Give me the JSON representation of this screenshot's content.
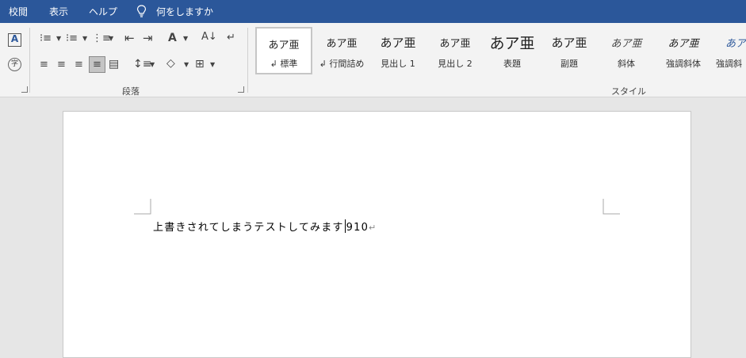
{
  "menu": {
    "items": [
      "校閲",
      "表示",
      "ヘルプ"
    ],
    "tell_me": "何をしますか"
  },
  "ribbon": {
    "paragraph_group_label": "段落",
    "styles_group_label": "スタイル",
    "styles": [
      {
        "preview": "あア亜",
        "name": "標準",
        "selected": true
      },
      {
        "preview": "あア亜",
        "name": "行間詰め"
      },
      {
        "preview": "あア亜",
        "name": "見出し 1"
      },
      {
        "preview": "あア亜",
        "name": "見出し 2"
      },
      {
        "preview": "あア亜",
        "name": "表題"
      },
      {
        "preview": "あア亜",
        "name": "副題"
      },
      {
        "preview": "あア亜",
        "name": "斜体"
      },
      {
        "preview": "あア亜",
        "name": "強調斜体"
      },
      {
        "preview": "あア",
        "name": "強調斜"
      }
    ]
  },
  "document": {
    "line_before_caret": "上書きされてしまうテストしてみます",
    "line_after_caret": "910",
    "para_mark": "↵"
  },
  "colors": {
    "menubar_bg": "#2b579a",
    "ribbon_bg": "#f3f3f3",
    "workspace_bg": "#e6e6e6"
  }
}
